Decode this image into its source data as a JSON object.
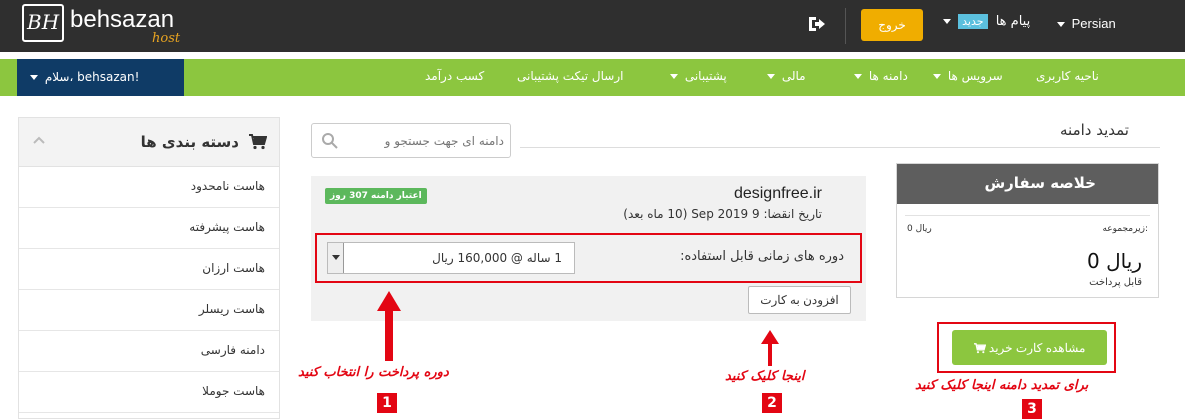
{
  "header": {
    "logo_mark": "BH",
    "logo_name": "behsazan",
    "logo_sub": "host",
    "language": "Persian",
    "messages_label": "پیام ها",
    "messages_badge": "جدید",
    "logout": "خروج"
  },
  "nav": {
    "items": [
      "ناحیه کاربری",
      "سرویس ها",
      "دامنه ها",
      "مالی",
      "پشتیبانی",
      "ارسال تیکت پشتیبانی",
      "کسب درآمد"
    ],
    "user": "سلام، behsazan!"
  },
  "page": {
    "title": "تمدید دامنه",
    "search_placeholder": "دامنه ای جهت جستجو و"
  },
  "sidebar": {
    "title": "دسته بندی ها",
    "items": [
      "هاست نامحدود",
      "هاست پیشرفته",
      "هاست ارزان",
      "هاست ریسلر",
      "دامنه فارسی",
      "هاست جوملا"
    ]
  },
  "domain": {
    "name": "designfree.ir",
    "expiry": "تاریخ انقضا: 9 Sep 2019 (10 ماه بعد)",
    "badge": "اعتبار دامنه 307 روز",
    "period_label": "دوره های زمانی قابل استفاده:",
    "selected_period": "1 ساله @ 160,000 ریال",
    "add_to_cart": "افزودن به کارت"
  },
  "summary": {
    "title": "خلاصه سفارش",
    "subtotal_label": "زیرمجموعه:",
    "subtotal_value": "0 ریال",
    "total": "0 ریال",
    "payable": "قابل پرداخت",
    "view_cart": "مشاهده کارت خرید"
  },
  "annotations": {
    "step1": "دوره پرداخت را انتخاب کنید",
    "step1_num": "1",
    "step2": "اینجا کلیک کنید",
    "step2_num": "2",
    "step3": "برای تمدید دامنه اینجا کلیک کنید",
    "step3_num": "3",
    "color": "#e30613"
  },
  "colors": {
    "header_bg": "#2f2f2f",
    "nav_green": "#8cc63f",
    "user_navy": "#0f3b66",
    "logout_yellow": "#f0ad00",
    "badge_green": "#5cb85c"
  }
}
